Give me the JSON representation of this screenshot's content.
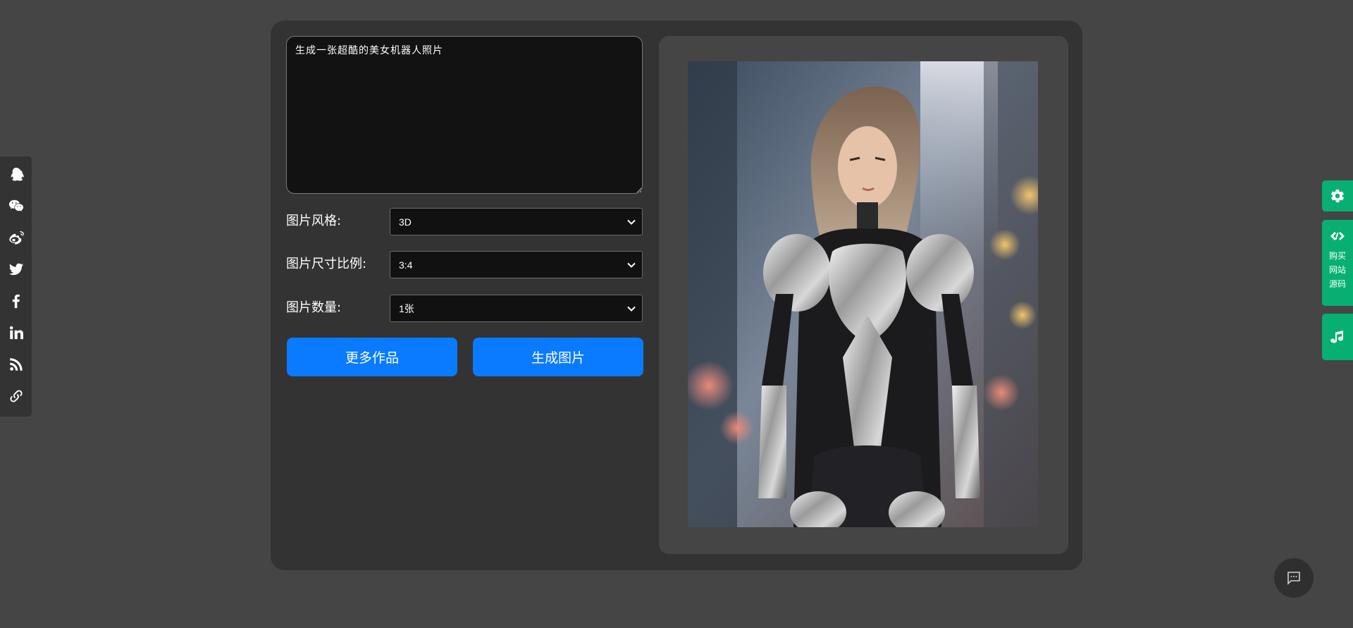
{
  "social_bar": {
    "icons": [
      "qq-icon",
      "wechat-icon",
      "weibo-icon",
      "twitter-icon",
      "facebook-icon",
      "linkedin-icon",
      "rss-icon",
      "link-icon"
    ]
  },
  "form": {
    "prompt_value": "生成一张超酷的美女机器人照片",
    "style_label": "图片风格:",
    "style_value": "3D",
    "ratio_label": "图片尺寸比例:",
    "ratio_value": "3:4",
    "count_label": "图片数量:",
    "count_value": "1张",
    "more_button": "更多作品",
    "generate_button": "生成图片"
  },
  "right_tools": {
    "settings_icon": "gear-icon",
    "buy_label_1": "购买",
    "buy_label_2": "网站",
    "buy_label_3": "源码",
    "buy_icon": "diamond-link-icon",
    "music_icon": "music-note-icon"
  },
  "chat": {
    "icon": "chat-bubble-icon"
  },
  "colors": {
    "background": "#454545",
    "panel": "#333333",
    "primary_button": "#0a7bff",
    "side_tool": "#07b072"
  }
}
